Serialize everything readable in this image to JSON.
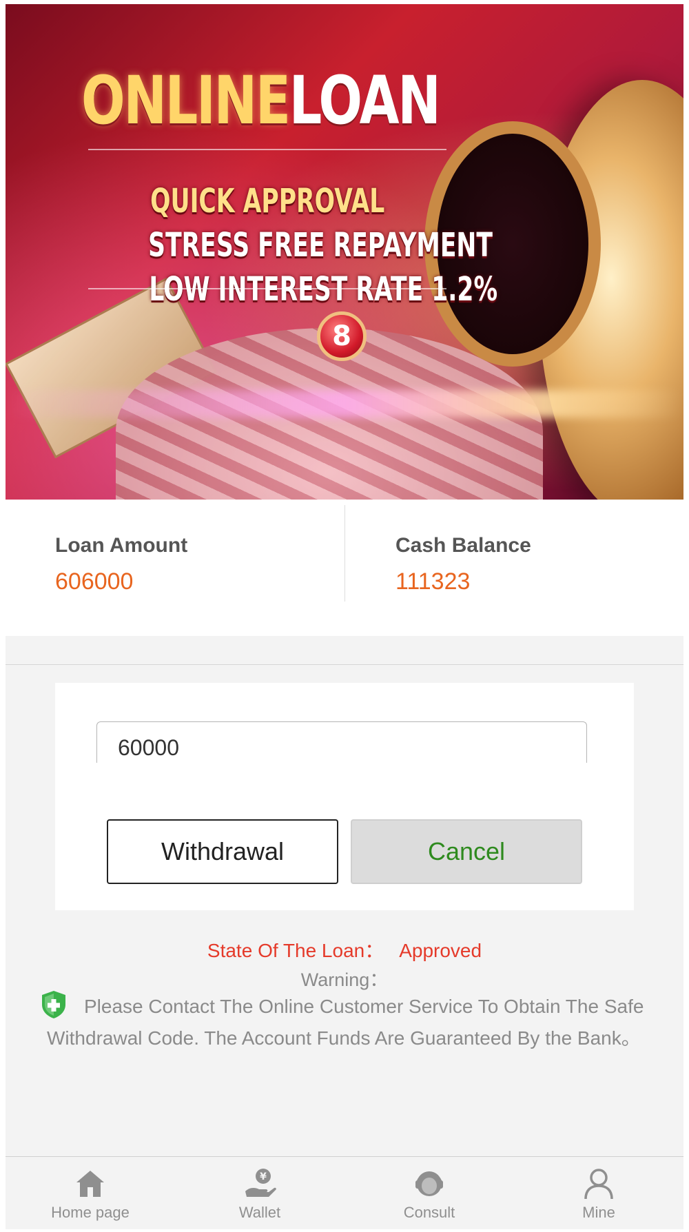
{
  "banner": {
    "title_part1": "ONLINE",
    "title_part2": "LOAN",
    "line1": "QUICK APPROVAL",
    "line2": "STRESS FREE REPAYMENT",
    "line3": "LOW INTEREST RATE 1.2%",
    "badge": "8"
  },
  "stats": {
    "loan_label": "Loan Amount",
    "loan_value": "606000",
    "cash_label": "Cash Balance",
    "cash_value": "111323"
  },
  "form": {
    "amount_value": "60000",
    "withdraw_label": "Withdrawal",
    "cancel_label": "Cancel"
  },
  "status": {
    "state_label": "State Of The Loan：",
    "state_value": "Approved",
    "warning_label": "Warning：",
    "notice": "Please Contact The Online Customer Service To Obtain The Safe Withdrawal Code. The Account Funds Are Guaranteed By the Bank。"
  },
  "nav": {
    "items": [
      {
        "label": "Home page",
        "icon": "home-icon"
      },
      {
        "label": "Wallet",
        "icon": "wallet-icon"
      },
      {
        "label": "Consult",
        "icon": "customer-service-icon"
      },
      {
        "label": "Mine",
        "icon": "user-icon"
      }
    ]
  },
  "colors": {
    "accent_orange": "#e8651f",
    "status_red": "#e53a2a",
    "cancel_green": "#2e8a1e",
    "shield_green": "#3bb24a",
    "muted_gray": "#8a8a8a"
  }
}
